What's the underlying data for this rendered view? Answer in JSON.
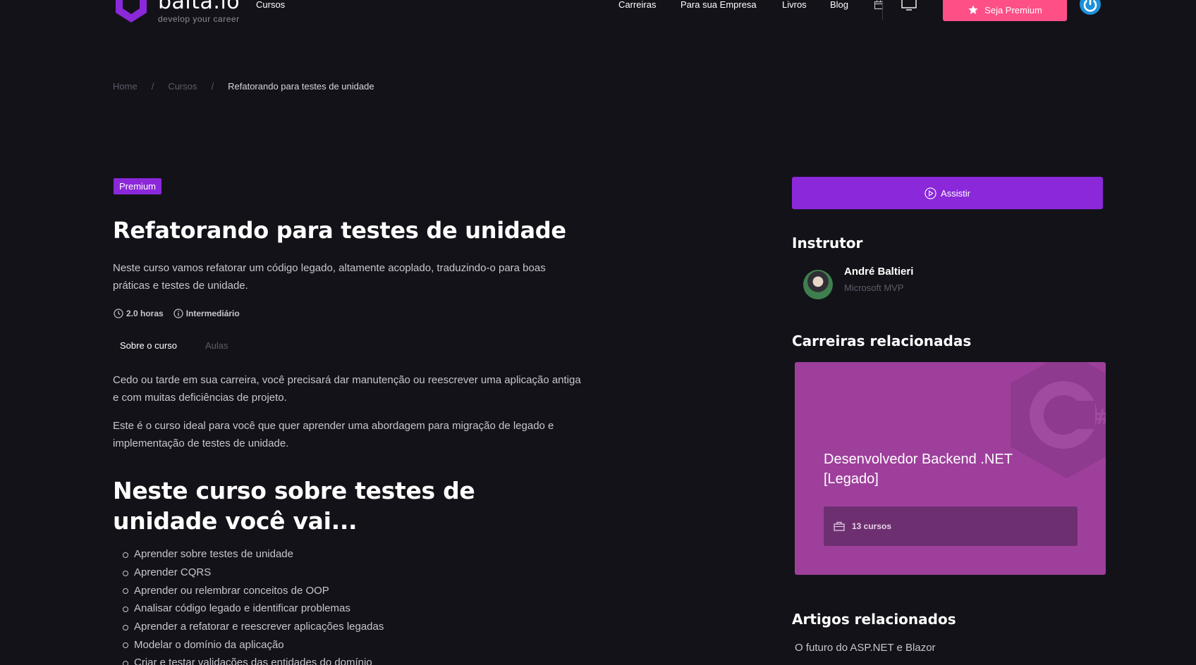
{
  "header": {
    "logo_name": "balta.io",
    "logo_tagline": "develop your career",
    "nav_left": "Cursos",
    "nav_right": [
      "Carreiras",
      "Para sua Empresa",
      "Livros",
      "Blog"
    ],
    "premium_button": "Seja Premium",
    "icons": [
      "calendar-icon",
      "monitor-icon",
      "star-icon",
      "power-icon"
    ],
    "colors": {
      "premium": "#fe4f87",
      "accent": "#8b28d9",
      "power": "#1e90d8"
    }
  },
  "breadcrumb": {
    "home": "Home",
    "separator": "/",
    "courses": "Cursos",
    "current": "Refatorando para testes de unidade"
  },
  "course": {
    "badge": "Premium",
    "title": "Refatorando para testes de unidade",
    "description": "Neste curso vamos refatorar um código legado, altamente acoplado, traduzindo-o para boas práticas e testes de unidade.",
    "duration": "2.0 horas",
    "level": "Intermediário",
    "tabs": [
      "Sobre o curso",
      "Aulas"
    ],
    "paragraphs": [
      "Cedo ou tarde em sua carreira, você precisará dar manutenção ou reescrever uma aplicação antiga e com muitas deficiências de projeto.",
      "Este é o curso ideal para você que quer aprender uma abordagem para migração de legado e implementação de testes de unidade."
    ],
    "learn_heading": "Neste curso sobre testes de unidade você vai...",
    "learn_items": [
      "Aprender sobre testes de unidade",
      "Aprender CQRS",
      "Aprender ou relembrar conceitos de OOP",
      "Analisar código legado e identificar problemas",
      "Aprender a refatorar e reescrever aplicações legadas",
      "Modelar o domínio da aplicação",
      "Criar e testar validações das entidades do domínio"
    ]
  },
  "sidebar": {
    "watch_button": "Assistir",
    "instructor_heading": "Instrutor",
    "instructor_name": "André Baltieri",
    "instructor_role": "Microsoft MVP",
    "careers_heading": "Carreiras relacionadas",
    "career_title": "Desenvolvedor Backend .NET [Legado]",
    "career_courses": "13 cursos",
    "articles_heading": "Artigos relacionados",
    "article_title": "O futuro do ASP.NET e Blazor"
  }
}
